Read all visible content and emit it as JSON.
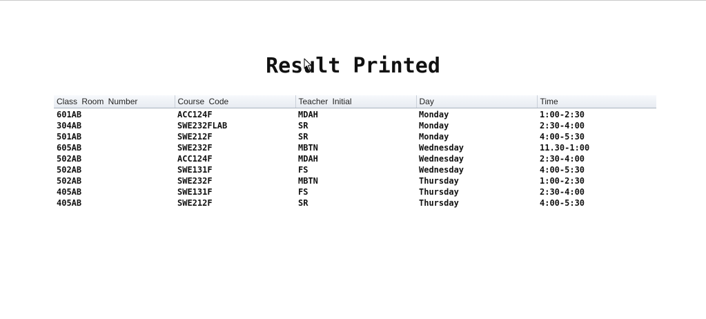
{
  "page": {
    "title": "Result Printed"
  },
  "table": {
    "columns": [
      "Class Room  Number",
      "Course  Code",
      "Teacher  Initial",
      "Day",
      "Time"
    ],
    "rows": [
      [
        "601AB",
        "ACC124F",
        "MDAH",
        "Monday",
        "1:00-2:30"
      ],
      [
        "304AB",
        "SWE232FLAB",
        "SR",
        "Monday",
        "2:30-4:00"
      ],
      [
        "501AB",
        "SWE212F",
        "SR",
        "Monday",
        "4:00-5:30"
      ],
      [
        "605AB",
        "SWE232F",
        "MBTN",
        "Wednesday",
        "11.30-1:00"
      ],
      [
        "502AB",
        "ACC124F",
        "MDAH",
        "Wednesday",
        "2:30-4:00"
      ],
      [
        "502AB",
        "SWE131F",
        "FS",
        "Wednesday",
        "4:00-5:30"
      ],
      [
        "502AB",
        "SWE232F",
        "MBTN",
        "Thursday",
        "1:00-2:30"
      ],
      [
        "405AB",
        "SWE131F",
        "FS",
        "Thursday",
        "2:30-4:00"
      ],
      [
        "405AB",
        "SWE212F",
        "SR",
        "Thursday",
        "4:00-5:30"
      ]
    ]
  },
  "icons": {
    "cursor": "mouse-pointer-icon"
  }
}
